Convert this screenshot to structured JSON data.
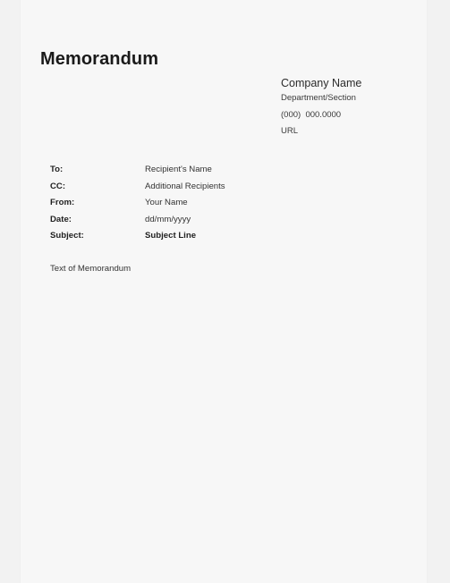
{
  "document": {
    "title": "Memorandum",
    "company": {
      "name": "Company Name",
      "department": "Department/Section",
      "phone": "(000)  000.0000",
      "url": "URL"
    },
    "fields": [
      {
        "label": "To:",
        "value": "Recipient's Name",
        "bold_value": false
      },
      {
        "label": "CC:",
        "value": "Additional Recipients",
        "bold_value": false
      },
      {
        "label": "From:",
        "value": "Your Name",
        "bold_value": false
      },
      {
        "label": "Date:",
        "value": "dd/mm/yyyy",
        "bold_value": false
      },
      {
        "label": "Subject:",
        "value": "Subject Line",
        "bold_value": true
      }
    ],
    "body": "Text of Memorandum"
  },
  "colors": {
    "page_background": "#f7f7f7",
    "canvas_background": "#f2f2f2",
    "title_text": "#1a1a1a",
    "body_text": "#333333"
  }
}
